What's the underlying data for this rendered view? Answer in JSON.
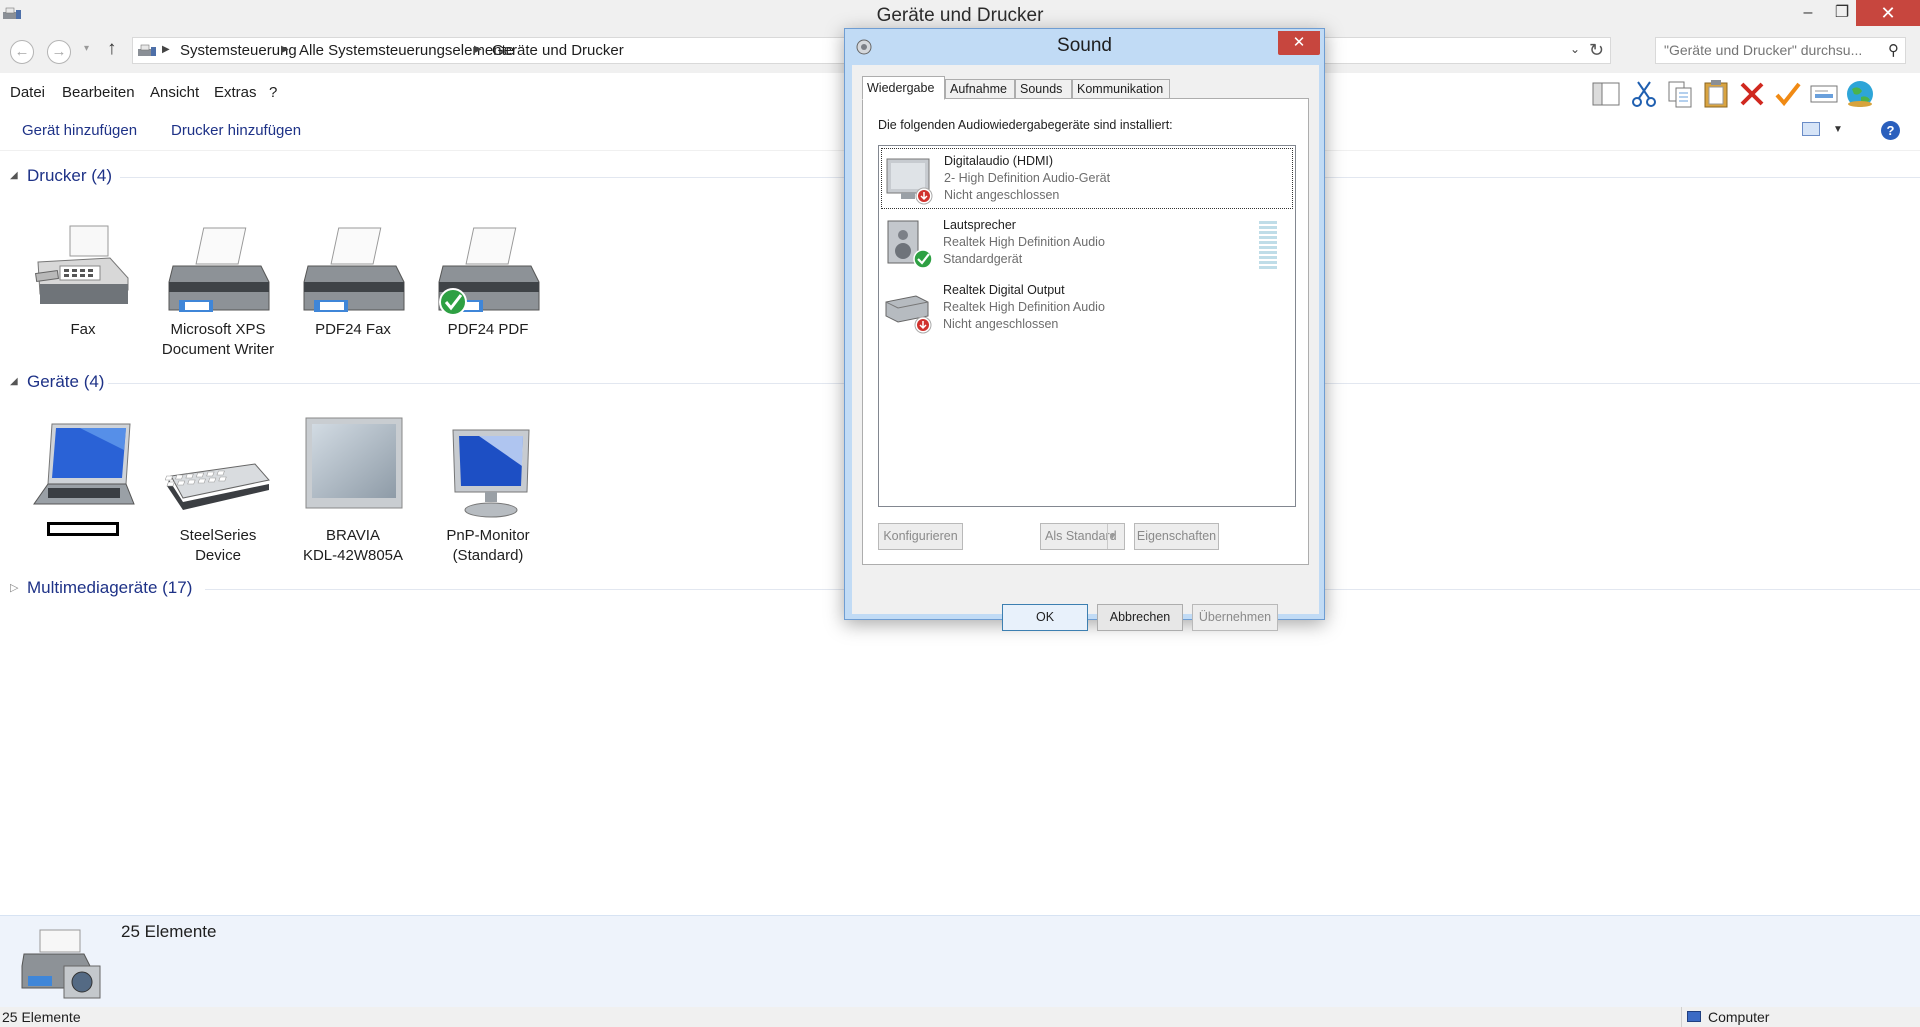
{
  "window": {
    "title": "Geräte und Drucker",
    "controls": {
      "minimize": "–",
      "maximize": "❐",
      "close": "✕"
    }
  },
  "address": {
    "nav_back": "←",
    "nav_forward": "→",
    "recent": "▾",
    "up": "↑",
    "breadcrumb": [
      "Systemsteuerung",
      "Alle Systemsteuerungselemente",
      "Geräte und Drucker"
    ],
    "dropdown": "⌄",
    "refresh": "↻"
  },
  "search": {
    "placeholder": "\"Geräte und Drucker\" durchsu...",
    "icon": "⚲"
  },
  "menu": [
    "Datei",
    "Bearbeiten",
    "Ansicht",
    "Extras",
    "?"
  ],
  "toolbar_icons": [
    "layout-icon",
    "cut-icon",
    "copy-icon",
    "paste-icon",
    "delete-icon",
    "checkmark-icon",
    "rename-icon",
    "globe-icon"
  ],
  "commands": [
    "Gerät hinzufügen",
    "Drucker hinzufügen"
  ],
  "help_label": "?",
  "groups": {
    "drucker": {
      "title": "Drucker (4)",
      "items": [
        {
          "label_1": "Fax",
          "label_2": ""
        },
        {
          "label_1": "Microsoft XPS",
          "label_2": "Document Writer"
        },
        {
          "label_1": "PDF24 Fax",
          "label_2": ""
        },
        {
          "label_1": "PDF24 PDF",
          "label_2": ""
        }
      ]
    },
    "geraete": {
      "title": "Geräte (4)",
      "items": [
        {
          "label_1": "",
          "label_2": ""
        },
        {
          "label_1": "SteelSeries",
          "label_2": "Device"
        },
        {
          "label_1": "BRAVIA",
          "label_2": "KDL-42W805A"
        },
        {
          "label_1": "PnP-Monitor",
          "label_2": "(Standard)"
        }
      ]
    },
    "multimedia": {
      "title": "Multimediageräte (17)"
    }
  },
  "details": {
    "count": "25 Elemente"
  },
  "status": {
    "left": "25 Elemente",
    "right": "Computer"
  },
  "sound_dialog": {
    "title": "Sound",
    "close": "✕",
    "tabs": [
      "Wiedergabe",
      "Aufnahme",
      "Sounds",
      "Kommunikation"
    ],
    "active_tab": "Wiedergabe",
    "intro": "Die folgenden Audiowiedergabegeräte sind installiert:",
    "devices": [
      {
        "name": "Digitalaudio (HDMI)",
        "driver": "2- High Definition Audio-Gerät",
        "state": "Nicht angeschlossen"
      },
      {
        "name": "Lautsprecher",
        "driver": "Realtek High Definition Audio",
        "state": "Standardgerät"
      },
      {
        "name": "Realtek Digital Output",
        "driver": "Realtek High Definition Audio",
        "state": "Nicht angeschlossen"
      }
    ],
    "buttons": {
      "configure": "Konfigurieren",
      "set_default": "Als Standard",
      "properties": "Eigenschaften",
      "ok": "OK",
      "cancel": "Abbrechen",
      "apply": "Übernehmen"
    }
  }
}
